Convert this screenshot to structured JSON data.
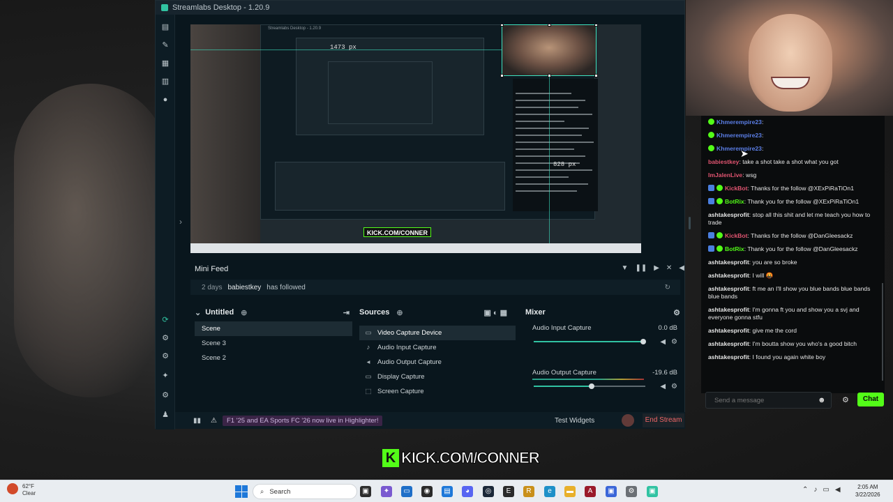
{
  "window": {
    "title": "Streamlabs Desktop - 1.20.9"
  },
  "preview": {
    "measure_width": "1473 px",
    "measure_height": "828 px",
    "watermark": "KICK.COM/CONNER",
    "inner_title": "Streamlabs Desktop - 1.20.9"
  },
  "mini_feed": {
    "title": "Mini Feed",
    "event": {
      "when": "2 days",
      "user": "babiestkey",
      "action": "has followed"
    }
  },
  "scenes": {
    "title": "Untitled",
    "items": [
      "Scene",
      "Scene 3",
      "Scene 2"
    ]
  },
  "sources": {
    "title": "Sources",
    "items": [
      {
        "label": "Video Capture Device",
        "icon": "video-icon"
      },
      {
        "label": "Audio Input Capture",
        "icon": "mic-icon"
      },
      {
        "label": "Audio Output Capture",
        "icon": "speaker-icon"
      },
      {
        "label": "Display Capture",
        "icon": "monitor-icon"
      },
      {
        "label": "Screen Capture",
        "icon": "screen-capture-icon"
      }
    ]
  },
  "mixer": {
    "title": "Mixer",
    "channels": [
      {
        "name": "Audio Input Capture",
        "db": "0.0 dB",
        "level": 0.98
      },
      {
        "name": "Audio Output Capture",
        "db": "-19.6 dB",
        "level": 0.52
      }
    ]
  },
  "footer": {
    "ticker": "F1 '25 and EA Sports FC '26 now live in Highlighter!",
    "test_widgets": "Test Widgets",
    "end_stream": "End Stream"
  },
  "chat": {
    "messages": [
      {
        "user": "Khmerempire23",
        "color": "#5b7ee6",
        "text": "",
        "badges": [
          "ver"
        ]
      },
      {
        "user": "Khmerempire23",
        "color": "#5b7ee6",
        "text": "",
        "badges": [
          "ver"
        ]
      },
      {
        "user": "Khmerempire23",
        "color": "#5b7ee6",
        "text": "",
        "badges": [
          "ver"
        ]
      },
      {
        "user": "babiestkey",
        "color": "#e05470",
        "text": "take a shot take a shot what you got",
        "badges": []
      },
      {
        "user": "ImJalenLive",
        "color": "#e05470",
        "text": "wsg",
        "badges": []
      },
      {
        "user": "KickBot",
        "color": "#e05470",
        "text": "Thanks for the follow @XExPiRaTiOn1",
        "badges": [
          "bot",
          "ver"
        ]
      },
      {
        "user": "BotRix",
        "color": "#53fc18",
        "text": "Thank you for the follow @XExPiRaTiOn1",
        "badges": [
          "bot",
          "ver"
        ]
      },
      {
        "user": "ashtakesprofit",
        "color": "#e6e6e6",
        "text": "stop all this shit and let me teach you how to trade",
        "badges": []
      },
      {
        "user": "KickBot",
        "color": "#e05470",
        "text": "Thanks for the follow @DanGleesackz",
        "badges": [
          "bot",
          "ver"
        ]
      },
      {
        "user": "BotRix",
        "color": "#53fc18",
        "text": "Thank you for the follow @DanGleesackz",
        "badges": [
          "bot",
          "ver"
        ]
      },
      {
        "user": "ashtakesprofit",
        "color": "#e6e6e6",
        "text": "you are so broke",
        "badges": []
      },
      {
        "user": "ashtakesprofit",
        "color": "#e6e6e6",
        "text": "I will 🤬",
        "badges": []
      },
      {
        "user": "ashtakesprofit",
        "color": "#e6e6e6",
        "text": "ft me an I'll show you blue bands blue bands blue bands",
        "badges": []
      },
      {
        "user": "ashtakesprofit",
        "color": "#e6e6e6",
        "text": "I'm gonna ft you and show you a svj and everyone gonna stfu",
        "badges": []
      },
      {
        "user": "ashtakesprofit",
        "color": "#e6e6e6",
        "text": "give me the cord",
        "badges": []
      },
      {
        "user": "ashtakesprofit",
        "color": "#e6e6e6",
        "text": "I'm boutta show you who's a good bitch",
        "badges": []
      },
      {
        "user": "ashtakesprofit",
        "color": "#e6e6e6",
        "text": "I found you again white boy",
        "badges": []
      }
    ],
    "input_placeholder": "Send a message",
    "send_label": "Chat"
  },
  "overlay": {
    "brand": "KICK.COM/CONNER"
  },
  "taskbar": {
    "weather_temp": "62°F",
    "weather_cond": "Clear",
    "search_label": "Search",
    "time": "2:05 AM",
    "date": "3/22/2026"
  },
  "colors": {
    "kick_green": "#53fc18",
    "streamlabs_teal": "#31c3a2",
    "end_stream_red": "#f06767"
  }
}
